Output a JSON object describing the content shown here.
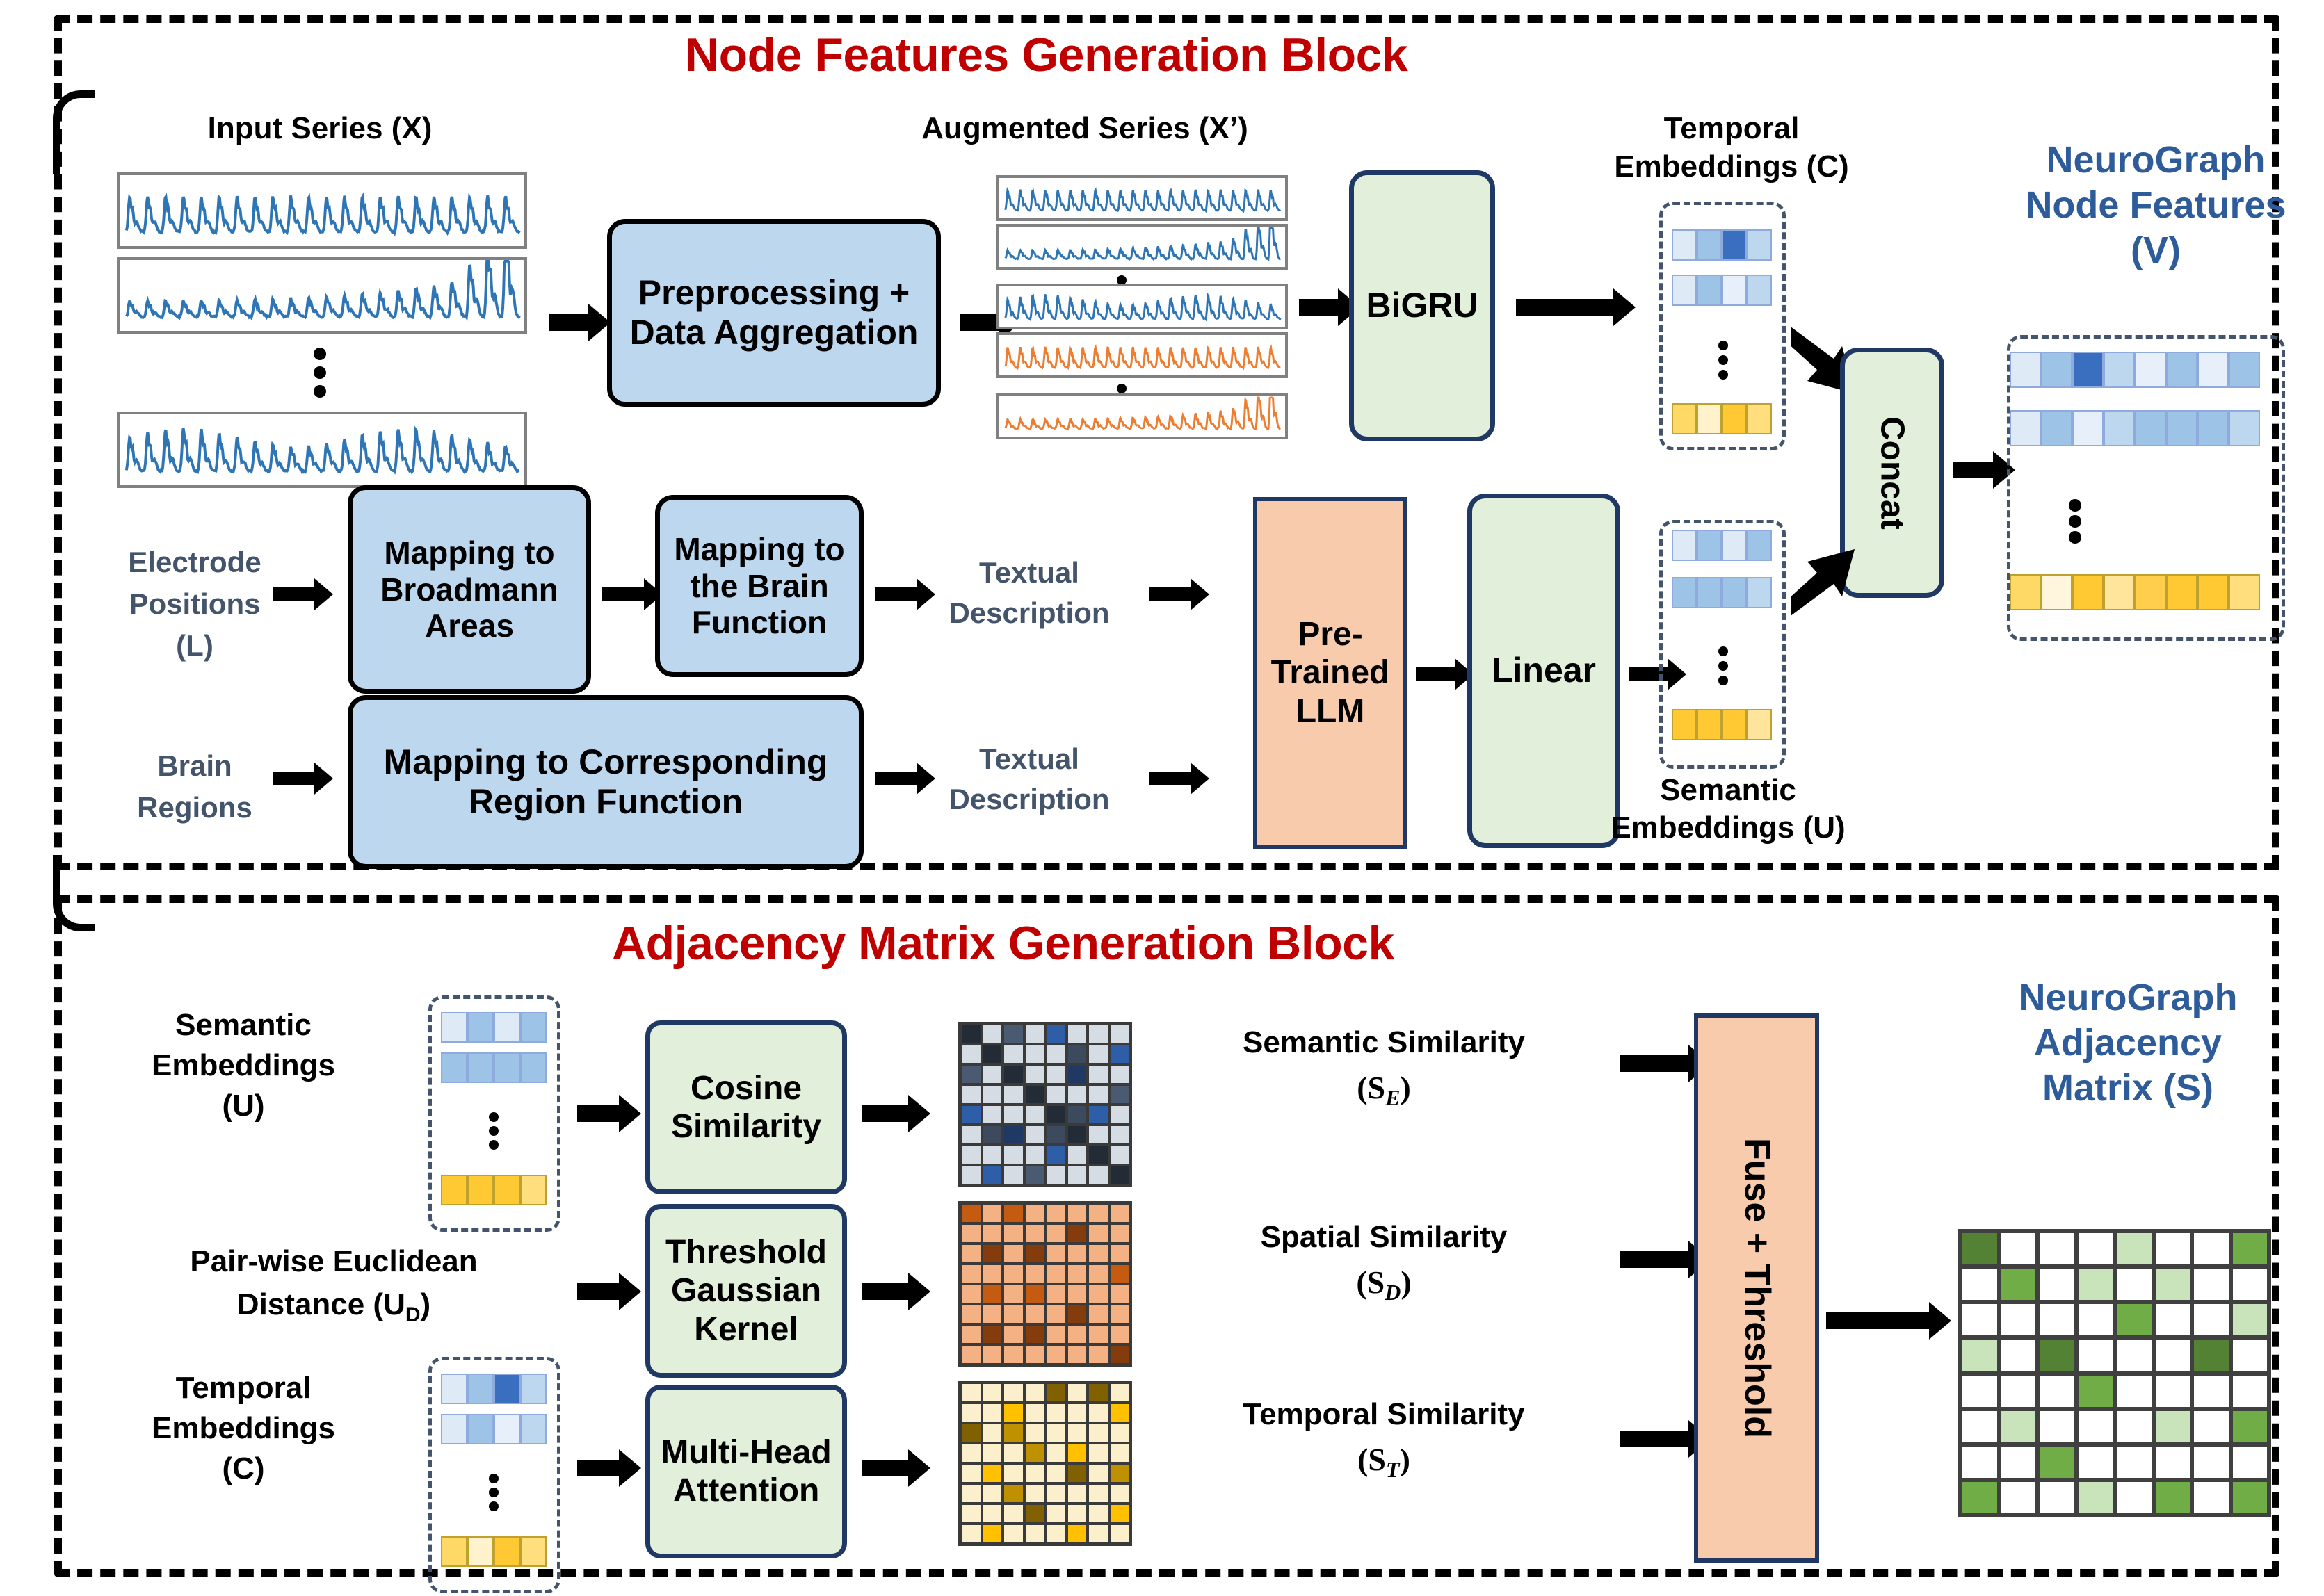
{
  "blocks": {
    "node": {
      "title": "Node Features Generation Block"
    },
    "adjacency": {
      "title": "Adjacency Matrix Generation Block"
    }
  },
  "node_block": {
    "captions": {
      "input_series": "Input Series (X)",
      "augmented_series": "Augmented Series (X’)",
      "temporal_embeddings": "Temporal\nEmbeddings (C)",
      "temporal_embeddings_l1": "Temporal",
      "temporal_embeddings_l2": "Embeddings (C)",
      "neurograph_node_features": "NeuroGraph\nNode Features\n(V)",
      "neurograph_l1": "NeuroGraph",
      "neurograph_l2": "Node Features",
      "neurograph_l3": "(V)",
      "semantic_embeddings_l1": "Semantic",
      "semantic_embeddings_l2": "Embeddings (U)"
    },
    "inputs": {
      "electrode_positions_l1": "Electrode",
      "electrode_positions_l2": "Positions",
      "electrode_positions_l3": "(L)",
      "brain_regions_l1": "Brain",
      "brain_regions_l2": "Regions"
    },
    "boxes": {
      "preprocessing": "Preprocessing + Data Aggregation",
      "bigru": "BiGRU",
      "mapping_broadmann": "Mapping to Broadmann Areas",
      "mapping_brain_function": "Mapping to the Brain Function",
      "mapping_region_function": "Mapping to Corresponding Region Function",
      "pretrained_llm": "Pre-Trained LLM",
      "linear": "Linear",
      "concat": "Concat"
    },
    "labels": {
      "textual_description_top_l1": "Textual",
      "textual_description_top_l2": "Description",
      "textual_description_bottom_l1": "Textual",
      "textual_description_bottom_l2": "Description"
    }
  },
  "adjacency_block": {
    "inputs": {
      "semantic_embeddings_l1": "Semantic",
      "semantic_embeddings_l2": "Embeddings",
      "semantic_embeddings_l3": "(U)",
      "euclidean_distance_l1": "Pair-wise Euclidean",
      "euclidean_distance_l2": "Distance (U",
      "euclidean_distance_sub": "D",
      "euclidean_distance_l3": ")",
      "temporal_embeddings_l1": "Temporal",
      "temporal_embeddings_l2": "Embeddings",
      "temporal_embeddings_l3": "(C)"
    },
    "boxes": {
      "cosine_similarity": "Cosine Similarity",
      "threshold_gaussian_kernel": "Threshold Gaussian Kernel",
      "multi_head_attention": "Multi-Head Attention",
      "fuse_threshold": "Fuse + Threshold"
    },
    "outputs": {
      "semantic_similarity_l1": "Semantic Similarity",
      "semantic_similarity_l2": "(S",
      "semantic_similarity_sub": "E",
      "semantic_similarity_l3": ")",
      "spatial_similarity_l1": "Spatial Similarity",
      "spatial_similarity_l2": "(S",
      "spatial_similarity_sub": "D",
      "spatial_similarity_l3": ")",
      "temporal_similarity_l1": "Temporal Similarity",
      "temporal_similarity_l2": "(S",
      "temporal_similarity_sub": "T",
      "temporal_similarity_l3": ")",
      "neurograph_adjacency_l1": "NeuroGraph",
      "neurograph_adjacency_l2": "Adjacency",
      "neurograph_adjacency_l3": "Matrix (S)"
    }
  },
  "colors": {
    "title_red": "#C00000",
    "caption_blue": "#2E5C9A",
    "label_slate": "#44546A",
    "box_blue_fill": "#BDD7EE",
    "box_green_fill": "#E2EFDA",
    "box_green_border": "#1F3864",
    "box_peach_fill": "#F8CBAD",
    "series_blue": "#2E75B6",
    "series_orange": "#ED7D31"
  },
  "chart_data": {
    "type": "heatmap",
    "title": "NeuroGraph pipeline matrices",
    "matrices": [
      {
        "name": "semantic_similarity",
        "symbol": "S_E",
        "rows": 8,
        "cols": 8,
        "palette": [
          "#D6DCE4",
          "#3C4A5E",
          "#2E5EA8",
          "#1F3864",
          "#222B36",
          "#4A5A70"
        ],
        "values": [
          [
            4,
            0,
            5,
            0,
            2,
            0,
            0,
            0
          ],
          [
            0,
            4,
            0,
            0,
            0,
            1,
            0,
            2
          ],
          [
            5,
            0,
            4,
            0,
            0,
            3,
            0,
            0
          ],
          [
            0,
            0,
            0,
            4,
            0,
            0,
            0,
            5
          ],
          [
            2,
            0,
            0,
            0,
            4,
            1,
            2,
            0
          ],
          [
            0,
            1,
            3,
            0,
            1,
            4,
            0,
            0
          ],
          [
            0,
            0,
            0,
            0,
            2,
            0,
            4,
            0
          ],
          [
            0,
            2,
            0,
            5,
            0,
            0,
            0,
            4
          ]
        ]
      },
      {
        "name": "spatial_similarity",
        "symbol": "S_D",
        "rows": 8,
        "cols": 8,
        "palette": [
          "#F4B183",
          "#C55A11",
          "#843C0C"
        ],
        "values": [
          [
            1,
            0,
            1,
            0,
            0,
            0,
            0,
            0
          ],
          [
            0,
            0,
            0,
            0,
            0,
            2,
            0,
            0
          ],
          [
            0,
            2,
            0,
            2,
            0,
            0,
            0,
            0
          ],
          [
            0,
            0,
            0,
            0,
            0,
            0,
            0,
            1
          ],
          [
            0,
            1,
            0,
            1,
            0,
            0,
            0,
            0
          ],
          [
            0,
            0,
            0,
            0,
            0,
            2,
            0,
            0
          ],
          [
            0,
            2,
            0,
            2,
            0,
            0,
            0,
            0
          ],
          [
            0,
            0,
            0,
            0,
            0,
            0,
            0,
            2
          ]
        ]
      },
      {
        "name": "temporal_similarity",
        "symbol": "S_T",
        "rows": 8,
        "cols": 8,
        "palette": [
          "#FCEFCB",
          "#FFC000",
          "#806000",
          "#BF9000"
        ],
        "values": [
          [
            0,
            0,
            0,
            0,
            2,
            0,
            2,
            0
          ],
          [
            0,
            0,
            1,
            0,
            0,
            0,
            0,
            1
          ],
          [
            2,
            0,
            3,
            0,
            0,
            0,
            0,
            0
          ],
          [
            0,
            0,
            0,
            3,
            0,
            1,
            0,
            0
          ],
          [
            0,
            1,
            0,
            0,
            0,
            2,
            0,
            3
          ],
          [
            0,
            0,
            3,
            0,
            0,
            0,
            0,
            0
          ],
          [
            0,
            0,
            0,
            2,
            0,
            0,
            0,
            1
          ],
          [
            0,
            1,
            0,
            0,
            0,
            1,
            0,
            0
          ]
        ]
      },
      {
        "name": "neurograph_adjacency_matrix",
        "symbol": "S",
        "rows": 8,
        "cols": 8,
        "palette": [
          "#FFFFFF",
          "#C9E3BB",
          "#70AD47",
          "#548235"
        ],
        "values": [
          [
            3,
            0,
            0,
            0,
            1,
            0,
            0,
            2
          ],
          [
            0,
            2,
            0,
            1,
            0,
            1,
            0,
            0
          ],
          [
            0,
            0,
            0,
            0,
            2,
            0,
            0,
            1
          ],
          [
            1,
            0,
            3,
            0,
            0,
            0,
            3,
            0
          ],
          [
            0,
            0,
            0,
            2,
            0,
            0,
            0,
            0
          ],
          [
            0,
            1,
            0,
            0,
            0,
            1,
            0,
            2
          ],
          [
            0,
            0,
            2,
            0,
            0,
            0,
            0,
            0
          ],
          [
            2,
            0,
            0,
            1,
            0,
            2,
            0,
            2
          ]
        ]
      }
    ],
    "embedding_strips": [
      {
        "name": "temporal_embeddings_top_C",
        "rows": [
          {
            "cells": [
              0.15,
              0.45,
              0.85,
              0.35
            ],
            "color": "blue"
          },
          {
            "cells": [
              0.15,
              0.45,
              0.12,
              0.3
            ],
            "color": "blue"
          },
          {
            "cells": [
              0.55,
              0.18,
              0.75,
              0.45
            ],
            "color": "yellow"
          }
        ]
      },
      {
        "name": "semantic_embeddings_U",
        "rows": [
          {
            "cells": [
              0.12,
              0.45,
              0.12,
              0.48
            ],
            "color": "blue"
          },
          {
            "cells": [
              0.48,
              0.48,
              0.48,
              0.28
            ],
            "color": "blue"
          },
          {
            "cells": [
              0.75,
              0.75,
              0.75,
              0.35
            ],
            "color": "yellow"
          }
        ]
      },
      {
        "name": "neurograph_node_features_V",
        "rows": [
          {
            "cells": [
              0.12,
              0.45,
              0.85,
              0.3,
              0.12,
              0.45,
              0.12,
              0.45
            ],
            "color": "blue"
          },
          {
            "cells": [
              0.12,
              0.45,
              0.1,
              0.28,
              0.45,
              0.45,
              0.45,
              0.28
            ],
            "color": "blue"
          },
          {
            "cells": [
              0.6,
              0.2,
              0.8,
              0.55,
              0.75,
              0.78,
              0.78,
              0.58
            ],
            "color": "yellow"
          }
        ]
      },
      {
        "name": "semantic_embeddings_adj_U",
        "rows": [
          {
            "cells": [
              0.12,
              0.45,
              0.2,
              0.48
            ],
            "color": "blue"
          },
          {
            "cells": [
              0.48,
              0.48,
              0.48,
              0.45
            ],
            "color": "blue"
          },
          {
            "cells": [
              0.75,
              0.75,
              0.75,
              0.6
            ],
            "color": "yellow"
          }
        ]
      },
      {
        "name": "temporal_embeddings_adj_C",
        "rows": [
          {
            "cells": [
              0.15,
              0.45,
              0.85,
              0.35
            ],
            "color": "blue"
          },
          {
            "cells": [
              0.15,
              0.45,
              0.12,
              0.3
            ],
            "color": "blue"
          },
          {
            "cells": [
              0.55,
              0.18,
              0.75,
              0.45
            ],
            "color": "yellow"
          }
        ]
      }
    ],
    "series_plots": {
      "input_series": [
        {
          "name": "x1",
          "color": "blue",
          "seed": 1
        },
        {
          "name": "x2",
          "color": "blue",
          "seed": 2
        },
        {
          "name": "xn",
          "color": "blue",
          "seed": 3
        }
      ],
      "augmented_series": [
        {
          "name": "x1a",
          "color": "blue",
          "seed": 4
        },
        {
          "name": "x2a",
          "color": "blue",
          "seed": 5
        },
        {
          "name": "x3a",
          "color": "blue",
          "seed": 6
        },
        {
          "name": "x4a",
          "color": "orange",
          "seed": 7
        },
        {
          "name": "xna",
          "color": "orange",
          "seed": 8
        }
      ]
    }
  }
}
